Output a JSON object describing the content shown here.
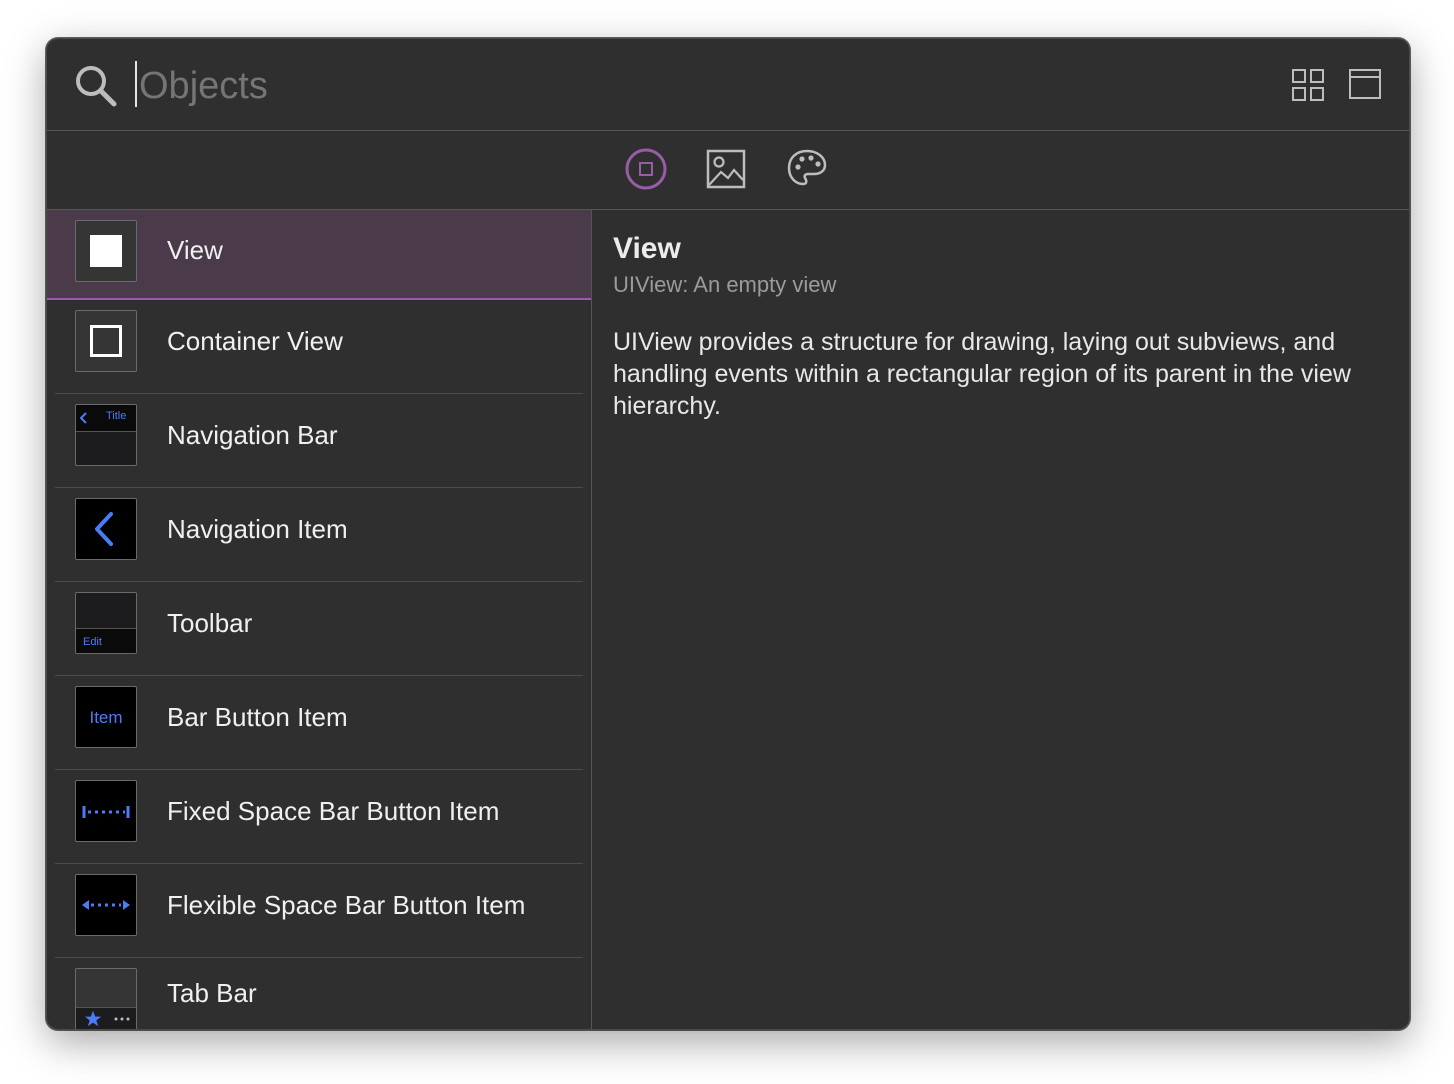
{
  "search": {
    "placeholder": "Objects",
    "value": ""
  },
  "toolbar": {
    "icons": [
      "search-icon",
      "grid-view-icon",
      "window-icon"
    ],
    "libraries": [
      {
        "name": "objects-library",
        "icon": "square-in-circle-icon",
        "selected": true
      },
      {
        "name": "media-library",
        "icon": "image-icon",
        "selected": false
      },
      {
        "name": "colors-library",
        "icon": "palette-icon",
        "selected": false
      }
    ],
    "accent_color": "#9a5ca8"
  },
  "list": {
    "items": [
      {
        "label": "View",
        "icon": "view-icon",
        "selected": true
      },
      {
        "label": "Container View",
        "icon": "container-view-icon",
        "selected": false
      },
      {
        "label": "Navigation Bar",
        "icon": "navigation-bar-icon",
        "thumb_text": "Title",
        "selected": false
      },
      {
        "label": "Navigation Item",
        "icon": "chevron-left-icon",
        "selected": false
      },
      {
        "label": "Toolbar",
        "icon": "toolbar-icon",
        "thumb_text": "Edit",
        "selected": false
      },
      {
        "label": "Bar Button Item",
        "icon": "bar-button-item-icon",
        "thumb_text": "Item",
        "selected": false
      },
      {
        "label": "Fixed Space Bar Button Item",
        "icon": "fixed-space-icon",
        "selected": false
      },
      {
        "label": "Flexible Space Bar Button Item",
        "icon": "flexible-space-icon",
        "selected": false
      },
      {
        "label": "Tab Bar",
        "icon": "tab-bar-icon",
        "selected": false
      }
    ]
  },
  "detail": {
    "title": "View",
    "subtitle": "UIView: An empty view",
    "description": "UIView provides a structure for drawing, laying out subviews, and handling events within a rectangular region of its parent in the view hierarchy."
  },
  "colors": {
    "window_bg": "#2f2f2f",
    "selected_row_bg": "#4a3a4a",
    "thumb_accent": "#4a7df5"
  }
}
